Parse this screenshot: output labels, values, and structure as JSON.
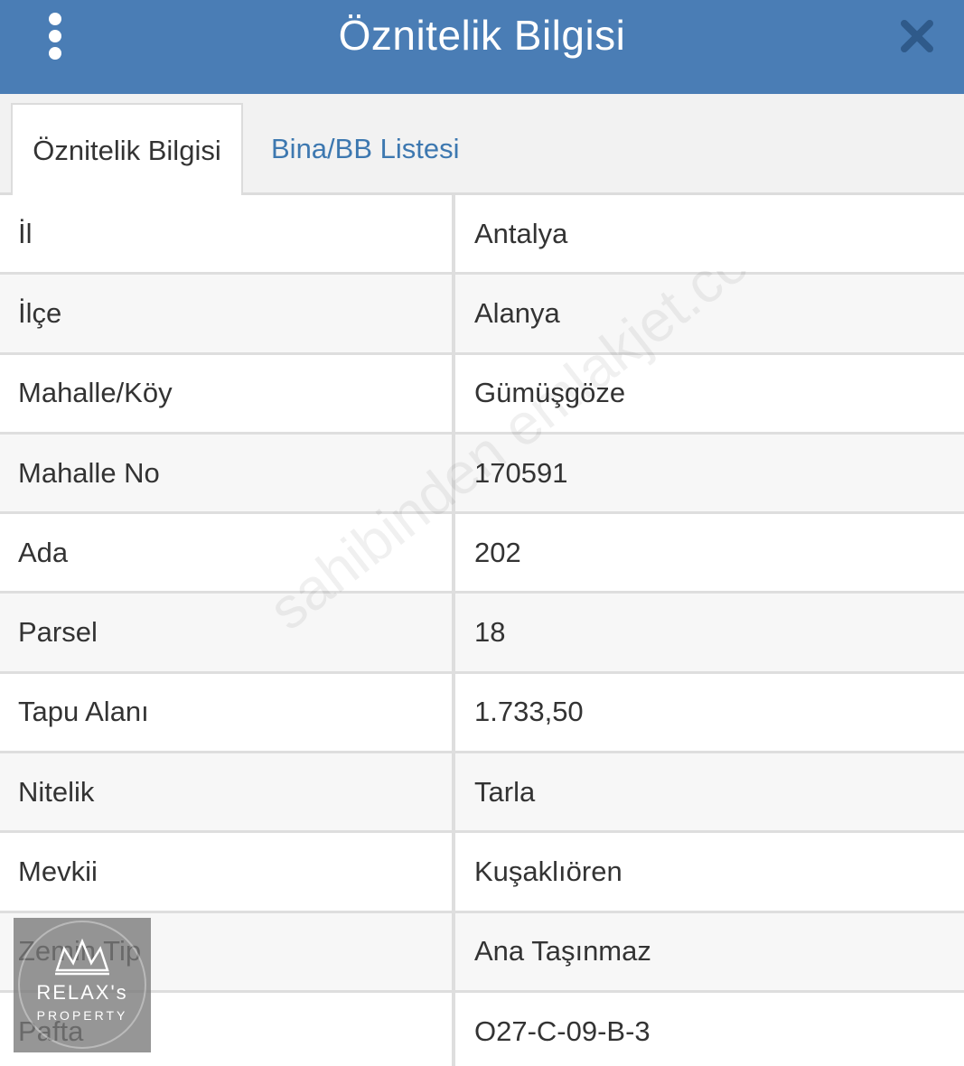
{
  "header": {
    "title": "Öznitelik Bilgisi",
    "menu_icon": "more-vertical-icon",
    "close_icon": "close-icon"
  },
  "tabs": [
    {
      "label": "Öznitelik Bilgisi",
      "active": true
    },
    {
      "label": "Bina/BB Listesi",
      "active": false
    }
  ],
  "rows": [
    {
      "label": "İl",
      "value": "Antalya"
    },
    {
      "label": "İlçe",
      "value": "Alanya"
    },
    {
      "label": "Mahalle/Köy",
      "value": "Gümüşgöze"
    },
    {
      "label": "Mahalle No",
      "value": "170591"
    },
    {
      "label": "Ada",
      "value": "202"
    },
    {
      "label": "Parsel",
      "value": "18"
    },
    {
      "label": "Tapu Alanı",
      "value": "1.733,50"
    },
    {
      "label": "Nitelik",
      "value": "Tarla"
    },
    {
      "label": "Mevkii",
      "value": "Kuşaklıören"
    },
    {
      "label": "Zemin Tip",
      "value": "Ana Taşınmaz"
    },
    {
      "label": "Pafta",
      "value": "O27-C-09-B-3"
    }
  ],
  "watermark": {
    "text": "sahibinden emlakjet.com"
  },
  "logo": {
    "brand": "RELAX's",
    "sub": "PROPERTY"
  },
  "colors": {
    "header_bg": "#4a7db5",
    "tab_link": "#3d78b0",
    "text": "#333333"
  }
}
